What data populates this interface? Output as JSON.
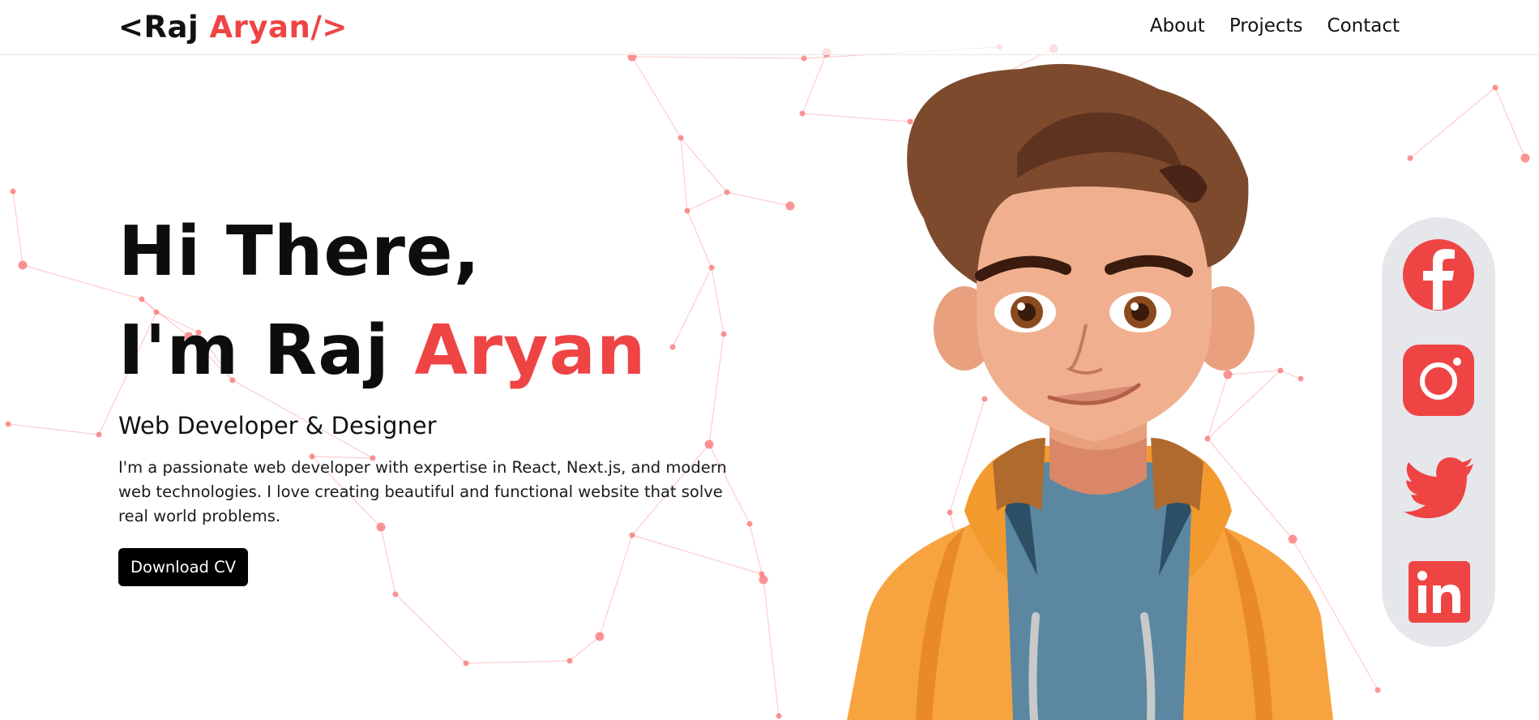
{
  "nav": {
    "logo_open": "<Raj ",
    "logo_accent": "Aryan/>",
    "links": [
      "About",
      "Projects",
      "Contact"
    ]
  },
  "hero": {
    "greeting_line1": "Hi There,",
    "greeting_line2_prefix": "I'm Raj ",
    "greeting_line2_accent": "Aryan",
    "role": "Web Developer & Designer",
    "bio": "I'm a passionate web developer with expertise in React, Next.js, and modern web technologies. I love creating beautiful and functional website that solve real world problems.",
    "cta_label": "Download CV"
  },
  "social": {
    "icons": [
      "facebook-icon",
      "instagram-icon",
      "twitter-icon",
      "linkedin-icon"
    ]
  },
  "colors": {
    "accent": "#ef4444",
    "button_bg": "#000000",
    "social_panel": "#e5e7eb",
    "network": "#f87171"
  }
}
